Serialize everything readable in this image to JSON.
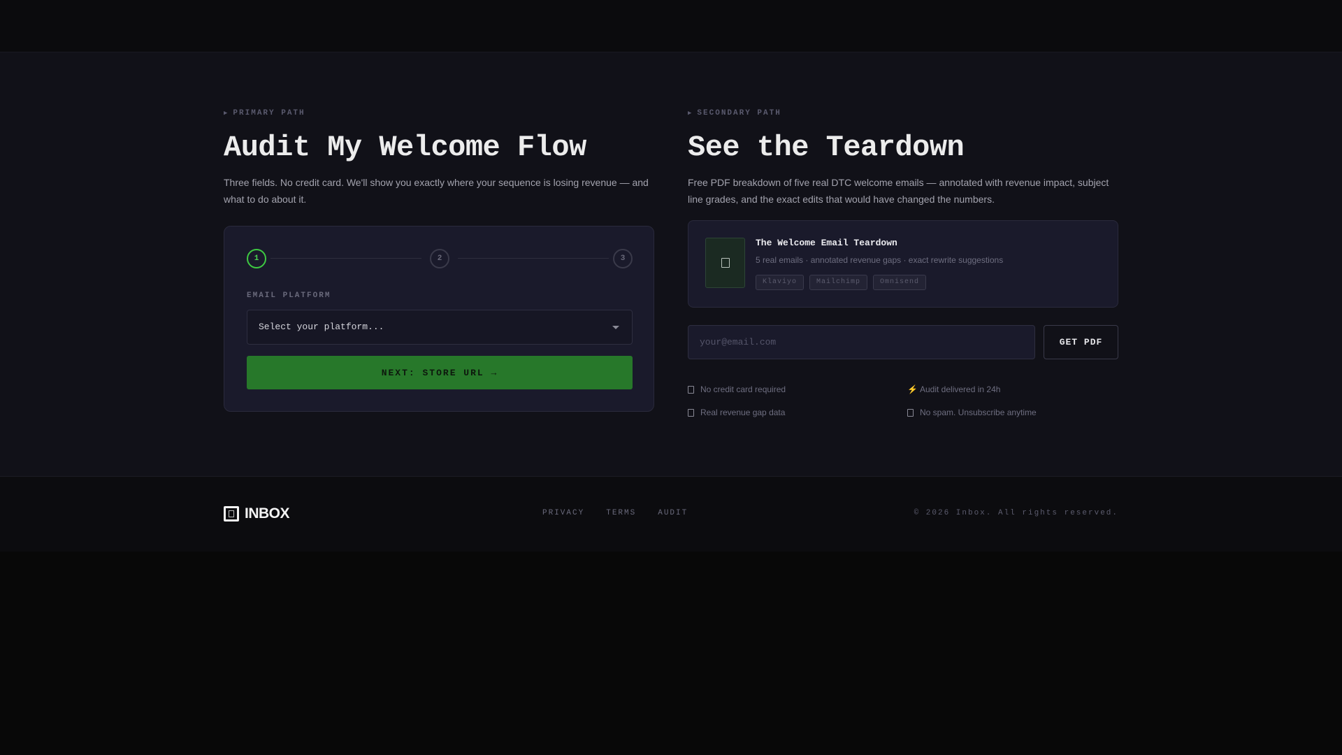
{
  "primary": {
    "eyebrow": "PRIMARY PATH",
    "title": "Audit My Welcome Flow",
    "description": "Three fields. No credit card. We'll show you exactly where your sequence is losing revenue — and what to do about it.",
    "steps": [
      "1",
      "2",
      "3"
    ],
    "active_step": 1,
    "field_label": "EMAIL PLATFORM",
    "select_value": "Select your platform...",
    "next_button": "NEXT: STORE URL →"
  },
  "secondary": {
    "eyebrow": "SECONDARY PATH",
    "title": "See the Teardown",
    "description": "Free PDF breakdown of five real DTC welcome emails — annotated with revenue impact, subject line grades, and the exact edits that would have changed the numbers.",
    "pdf": {
      "title": "The Welcome Email Teardown",
      "description": "5 real emails · annotated revenue gaps · exact rewrite suggestions",
      "tags": [
        "Klaviyo",
        "Mailchimp",
        "Omnisend"
      ]
    },
    "email_placeholder": "your@email.com",
    "get_pdf_button": "GET PDF",
    "features": [
      {
        "icon": "checkbox-icon",
        "text": "No credit card required"
      },
      {
        "icon": "lightning-icon",
        "text": "Audit delivered in 24h"
      },
      {
        "icon": "checkbox-icon",
        "text": "Real revenue gap data"
      },
      {
        "icon": "checkbox-icon",
        "text": "No spam. Unsubscribe anytime"
      }
    ]
  },
  "footer": {
    "logo_text": "INBOX",
    "links": [
      "PRIVACY",
      "TERMS",
      "AUDIT"
    ],
    "copyright": "© 2026 Inbox. All rights reserved."
  },
  "colors": {
    "accent_green": "#3ec942",
    "button_green": "#27782a",
    "card_bg": "#1a1a2b",
    "section_bg": "#111118"
  }
}
